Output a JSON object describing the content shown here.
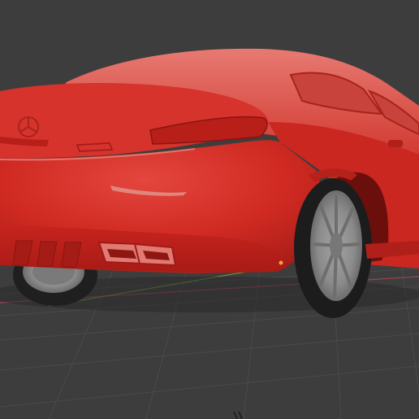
{
  "viewport": {
    "background_color": "#3d3d3d",
    "grid_line_color": "#4a4a4a",
    "x_axis_color": "#c9475c",
    "y_axis_color": "#7fa533",
    "model_body_color": "#d42a23",
    "model_highlight_color": "#e5675f",
    "model_shadow_color": "#9c1a16",
    "tire_color": "#232323",
    "rim_color": "#8a8a8a",
    "exhaust_color": "#e07a72",
    "object_origin_color": "#f2a33a"
  },
  "scene": {
    "object": "car-3d-model",
    "view": "rear-three-quarter",
    "visible_parts": [
      "rear-bumper",
      "tail-lights",
      "trunk-emblem",
      "exhaust-tips",
      "rear-wheel-right",
      "rear-wheel-left"
    ]
  }
}
